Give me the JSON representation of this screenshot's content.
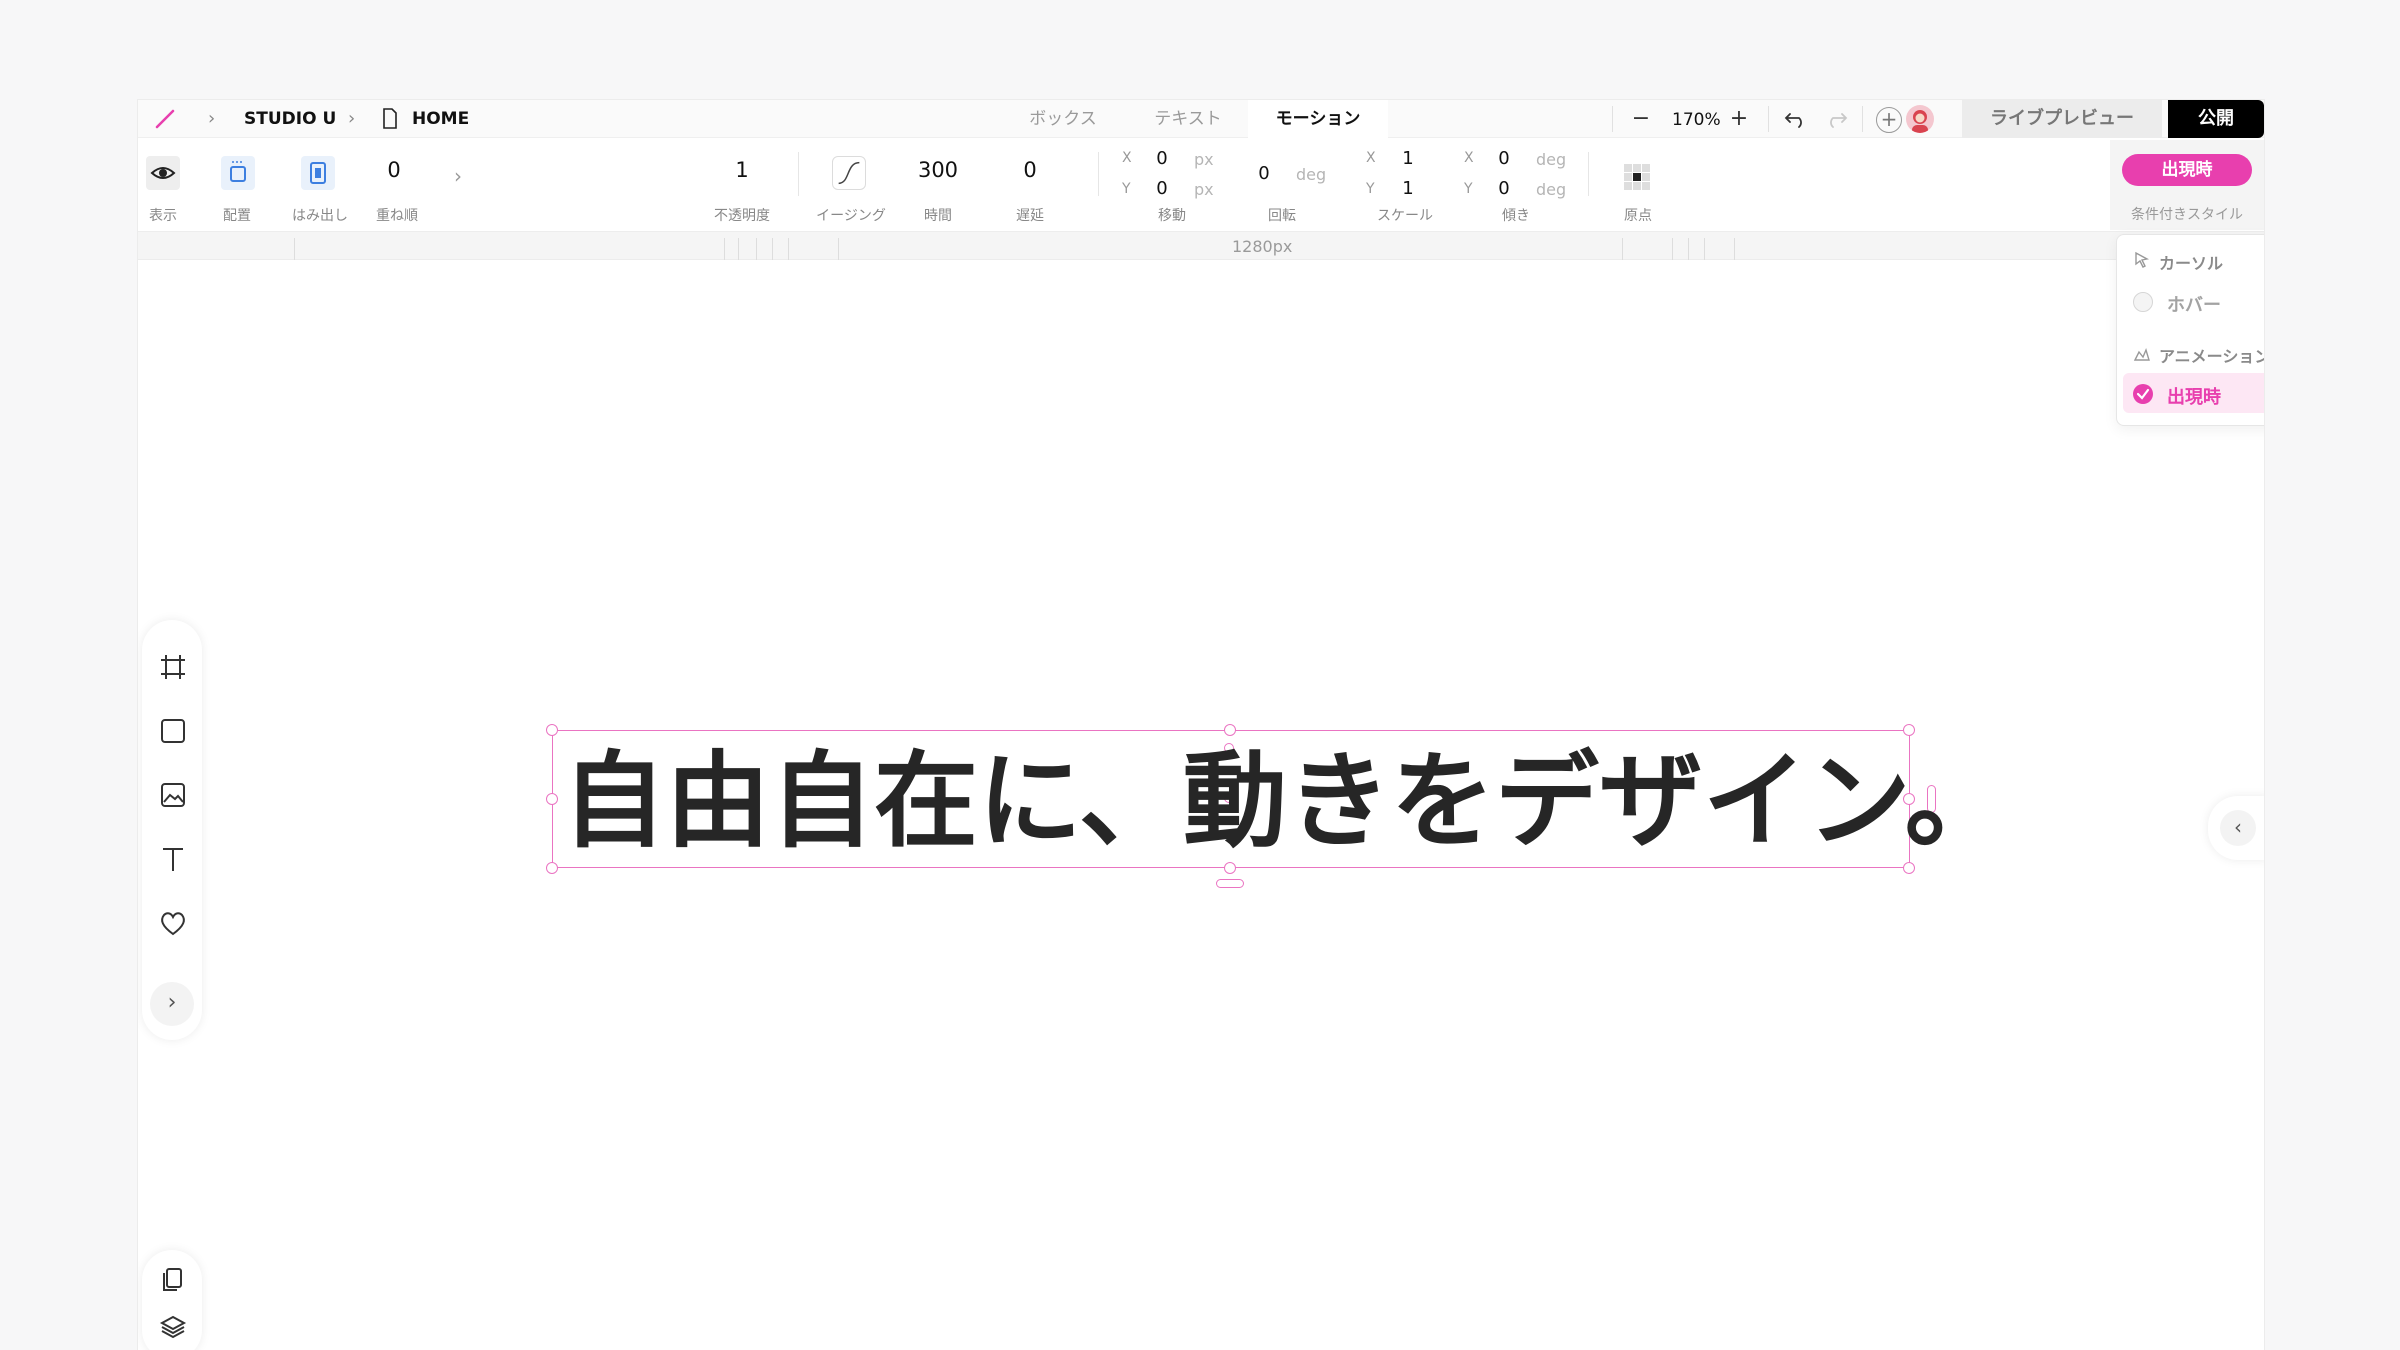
{
  "header": {
    "breadcrumb_project": "STUDIO U",
    "breadcrumb_page": "HOME"
  },
  "tabs": [
    {
      "label": "ボックス",
      "active": false
    },
    {
      "label": "テキスト",
      "active": false
    },
    {
      "label": "モーション",
      "active": true
    }
  ],
  "zoom": {
    "value": "170%"
  },
  "actions": {
    "live_preview": "ライブプレビュー",
    "publish": "公開"
  },
  "toolbar": {
    "display_label": "表示",
    "layout_label": "配置",
    "overflow_label": "はみ出し",
    "stack_value": "0",
    "stack_label": "重ね順",
    "opacity_value": "1",
    "opacity_label": "不透明度",
    "easing_label": "イージング",
    "duration_value": "300",
    "duration_label": "時間",
    "delay_value": "0",
    "delay_label": "遅延",
    "move": {
      "x": "0",
      "y": "0",
      "unit": "px",
      "label": "移動",
      "x_axis": "X",
      "y_axis": "Y"
    },
    "rotate": {
      "value": "0",
      "unit": "deg",
      "label": "回転"
    },
    "scale": {
      "x": "1",
      "y": "1",
      "label": "スケール",
      "x_axis": "X",
      "y_axis": "Y"
    },
    "skew": {
      "x": "0",
      "y": "0",
      "unit": "deg",
      "label": "傾き",
      "x_axis": "X",
      "y_axis": "Y"
    },
    "origin_label": "原点",
    "conditional_button": "出現時",
    "conditional_label": "条件付きスタイル"
  },
  "ruler": {
    "width_label": "1280px"
  },
  "dropdown": {
    "section_cursor": "カーソル",
    "item_hover": "ホバー",
    "section_animation": "アニメーション",
    "item_appear": "出現時"
  },
  "canvas": {
    "headline": "自由自在に、動きをデザイン。"
  },
  "colors": {
    "accent": "#e83fae",
    "selection": "#ea74c2",
    "publish_bg": "#000000"
  }
}
